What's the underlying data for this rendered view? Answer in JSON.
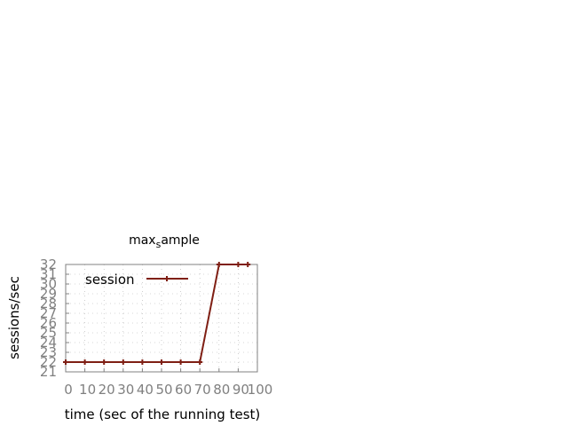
{
  "chart_data": {
    "type": "line",
    "title_main": "max",
    "title_sub": "s",
    "title_rest": "ample",
    "xlabel": "time (sec of the running test)",
    "ylabel": "sessions/sec",
    "xlim": [
      0,
      100
    ],
    "ylim": [
      21,
      32
    ],
    "x_ticks": [
      "0",
      "10",
      "20",
      "30",
      "40",
      "50",
      "60",
      "70",
      "80",
      "90",
      "100"
    ],
    "y_ticks": [
      "21",
      "22",
      "23",
      "24",
      "25",
      "26",
      "27",
      "28",
      "29",
      "30",
      "31",
      "32"
    ],
    "grid": true,
    "legend_position": "top-left",
    "series": [
      {
        "name": "session",
        "color": "#7f1f14",
        "x": [
          0,
          10,
          20,
          30,
          40,
          50,
          60,
          70,
          80,
          90,
          95
        ],
        "y": [
          22,
          22,
          22,
          22,
          22,
          22,
          22,
          22,
          32,
          32,
          32
        ]
      }
    ]
  }
}
